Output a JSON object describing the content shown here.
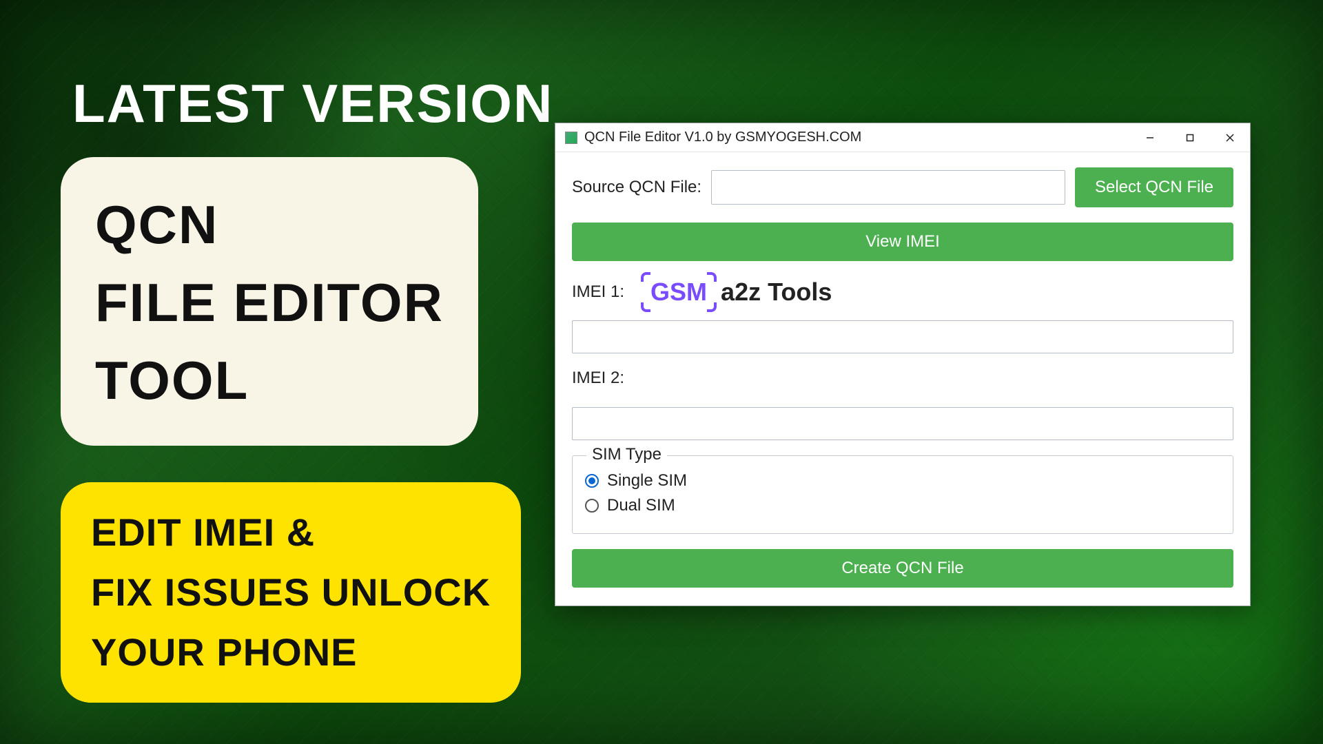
{
  "headline": "LATEST VERSION",
  "cream": {
    "l1": "QCN",
    "l2": "FILE EDITOR",
    "l3": "TOOL"
  },
  "yellow": {
    "l1": "EDIT IMEI &",
    "l2": "FIX ISSUES UNLOCK",
    "l3": "YOUR PHONE"
  },
  "window": {
    "title": "QCN File Editor V1.0 by GSMYOGESH.COM",
    "source_label": "Source QCN File:",
    "source_value": "",
    "select_btn": "Select QCN File",
    "view_btn": "View IMEI",
    "imei1_label": "IMEI 1:",
    "imei1_value": "",
    "imei2_label": "IMEI 2:",
    "imei2_value": "",
    "watermark_gsm": "GSM",
    "watermark_a2z": "a2z Tools",
    "sim_type_legend": "SIM Type",
    "sim_single": "Single SIM",
    "sim_dual": "Dual SIM",
    "sim_selected": "single",
    "create_btn": "Create QCN File"
  },
  "colors": {
    "accent_green": "#4caf50",
    "accent_purple": "#7a4cff",
    "yellow": "#ffe300",
    "cream": "#f9f5e6"
  }
}
